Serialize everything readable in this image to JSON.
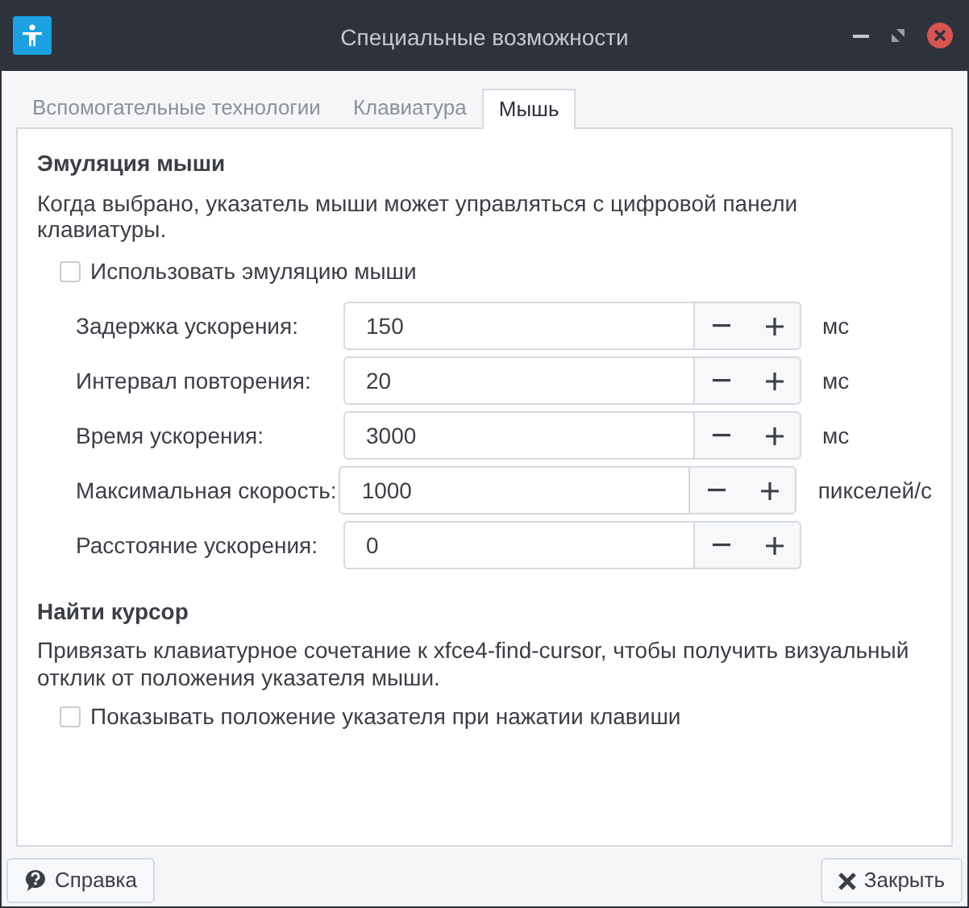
{
  "window": {
    "title": "Специальные возможности"
  },
  "tabs": [
    {
      "label": "Вспомогательные технологии",
      "selected": false
    },
    {
      "label": "Клавиатура",
      "selected": false
    },
    {
      "label": "Мышь",
      "selected": true
    }
  ],
  "mouse_emulation": {
    "heading": "Эмуляция мыши",
    "description": "Когда выбрано, указатель мыши может управляться с цифровой панели клавиатуры.",
    "checkbox": {
      "label": "Использовать эмуляцию мыши",
      "checked": false,
      "disabled": false
    },
    "settings": [
      {
        "label": "Задержка ускорения:",
        "value": "150",
        "unit": "мс"
      },
      {
        "label": "Интервал повторения:",
        "value": "20",
        "unit": "мс"
      },
      {
        "label": "Время ускорения:",
        "value": "3000",
        "unit": "мс"
      },
      {
        "label": "Максимальная скорость:",
        "value": "1000",
        "unit": "пикселей/с"
      },
      {
        "label": "Расстояние ускорения:",
        "value": "0"
      }
    ]
  },
  "find_cursor": {
    "heading": "Найти курсор",
    "description": "Привязать клавиатурное сочетание к xfce4-find-cursor, чтобы получить визуальный отклик от положения указателя мыши.",
    "checkbox": {
      "label": "Показывать положение указателя при нажатии клавиши",
      "checked": false,
      "disabled": false
    }
  },
  "buttons": [
    {
      "kind": "help",
      "label": "Справка"
    },
    {
      "kind": "close",
      "label": "Закрыть"
    }
  ]
}
